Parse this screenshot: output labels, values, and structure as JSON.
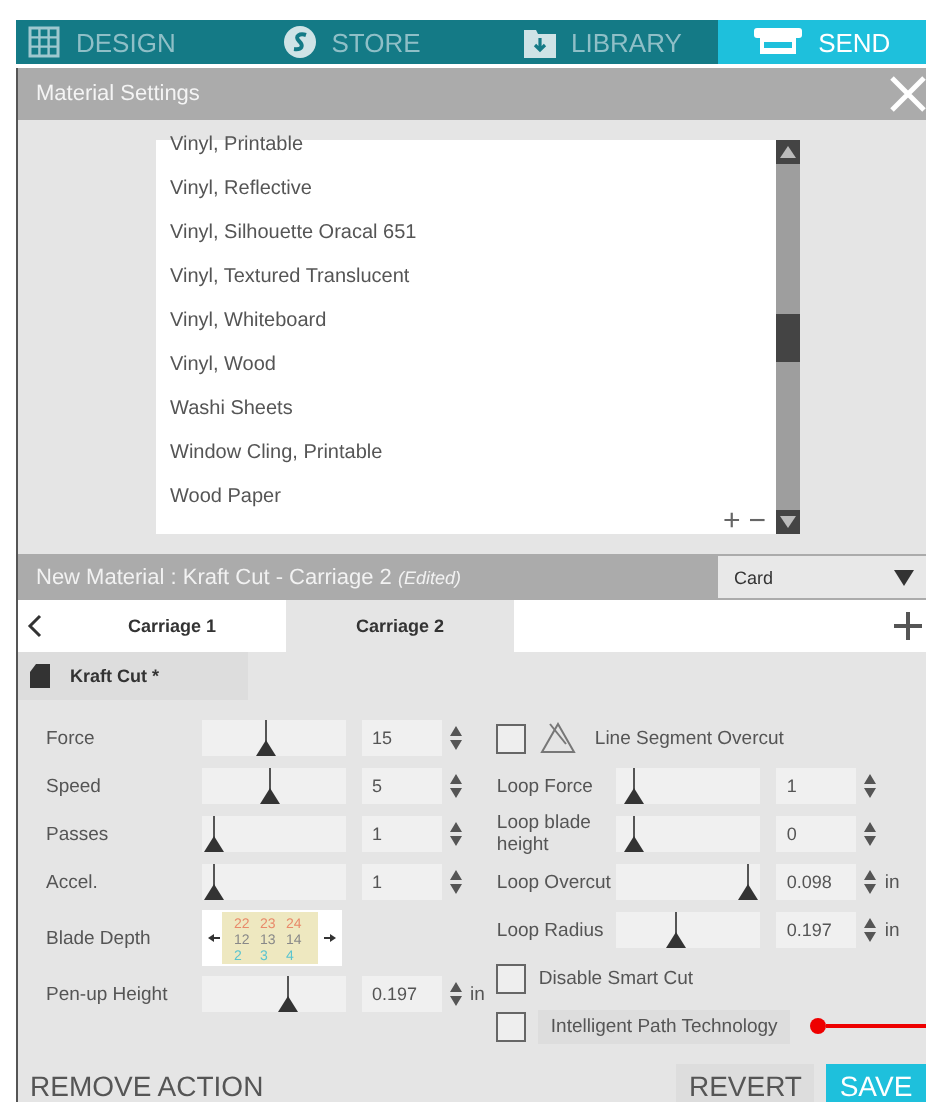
{
  "nav_tabs": [
    {
      "label": "DESIGN",
      "selected": false
    },
    {
      "label": "STORE",
      "selected": false
    },
    {
      "label": "LIBRARY",
      "selected": false
    },
    {
      "label": "SEND",
      "selected": true
    }
  ],
  "panel": {
    "title": "Material Settings"
  },
  "materials": [
    "Vinyl, Printable",
    "Vinyl, Reflective",
    "Vinyl, Silhouette Oracal 651",
    "Vinyl, Textured Translucent",
    "Vinyl, Whiteboard",
    "Vinyl, Wood",
    "Washi Sheets",
    "Window Cling, Printable",
    "Wood Paper"
  ],
  "list_buttons": [
    "+",
    "−"
  ],
  "material_header": {
    "title": "New Material : Kraft Cut - Carriage 2",
    "note": "(Edited)",
    "dropdown": "Card"
  },
  "carriage_tabs": [
    {
      "label": "Carriage 1",
      "selected": false
    },
    {
      "label": "Carriage 2",
      "selected": true
    }
  ],
  "tool": {
    "label": "Kraft Cut *"
  },
  "left_params": [
    {
      "kind": "slider",
      "label": "Force",
      "level": 0.44,
      "value": "15"
    },
    {
      "kind": "slider",
      "label": "Speed",
      "level": 0.47,
      "value": "5"
    },
    {
      "kind": "slider",
      "label": "Passes",
      "level": 0.02,
      "value": "1"
    },
    {
      "kind": "slider",
      "label": "Accel.",
      "level": 0.02,
      "value": "1"
    },
    {
      "kind": "blade",
      "label": "Blade Depth",
      "rows": [
        [
          "22",
          "23",
          "24"
        ],
        [
          "12",
          "13",
          "14"
        ],
        [
          "2",
          "3",
          "4"
        ]
      ]
    },
    {
      "kind": "slider",
      "label": "Pen-up Height",
      "level": 0.62,
      "value": "0.197",
      "unit": "in"
    }
  ],
  "right_params": [
    {
      "kind": "overcut",
      "label": "Line Segment Overcut",
      "checked": false
    },
    {
      "kind": "slider",
      "label": "Loop Force",
      "level": 0.05,
      "value": "1"
    },
    {
      "kind": "slider",
      "label": "Loop blade height",
      "level": 0.05,
      "value": "0"
    },
    {
      "kind": "slider",
      "label": "Loop Overcut",
      "level": 0.97,
      "value": "0.098",
      "unit": "in"
    },
    {
      "kind": "slider",
      "label": "Loop Radius",
      "level": 0.4,
      "value": "0.197",
      "unit": "in"
    },
    {
      "kind": "checkbox",
      "label": "Disable Smart Cut",
      "checked": false
    },
    {
      "kind": "checkbox",
      "label": "Intelligent Path Technology",
      "checked": false,
      "highlight": true
    }
  ],
  "actions": {
    "remove": "REMOVE ACTION",
    "revert": "REVERT",
    "save": "SAVE"
  }
}
